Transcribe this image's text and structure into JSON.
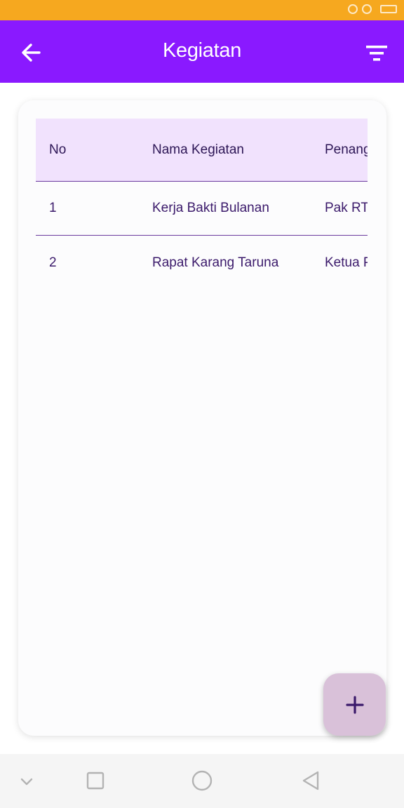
{
  "status_bar": {
    "left_text": "",
    "time": "",
    "battery": ""
  },
  "app_bar": {
    "title": "Kegiatan",
    "back_icon": "arrow-left-icon",
    "filter_icon": "filter-icon"
  },
  "table": {
    "headers": [
      "No",
      "Nama Kegiatan",
      "Penang"
    ],
    "rows": [
      [
        "1",
        "Kerja Bakti Bulanan",
        "Pak RT"
      ],
      [
        "2",
        "Rapat Karang Taruna",
        "Ketua P"
      ]
    ]
  },
  "fab": {
    "icon": "plus-icon"
  },
  "nav_bar": {
    "icons": [
      "chevron-down-icon",
      "square-icon",
      "circle-icon",
      "triangle-back-icon"
    ]
  },
  "colors": {
    "status_bar": "#f6a81f",
    "app_bar": "#8a19ff",
    "table_header_bg": "#f1e2fd",
    "row_divider": "#6a3a9e",
    "text": "#3b1a6b",
    "fab_bg": "#d9c1d9"
  }
}
